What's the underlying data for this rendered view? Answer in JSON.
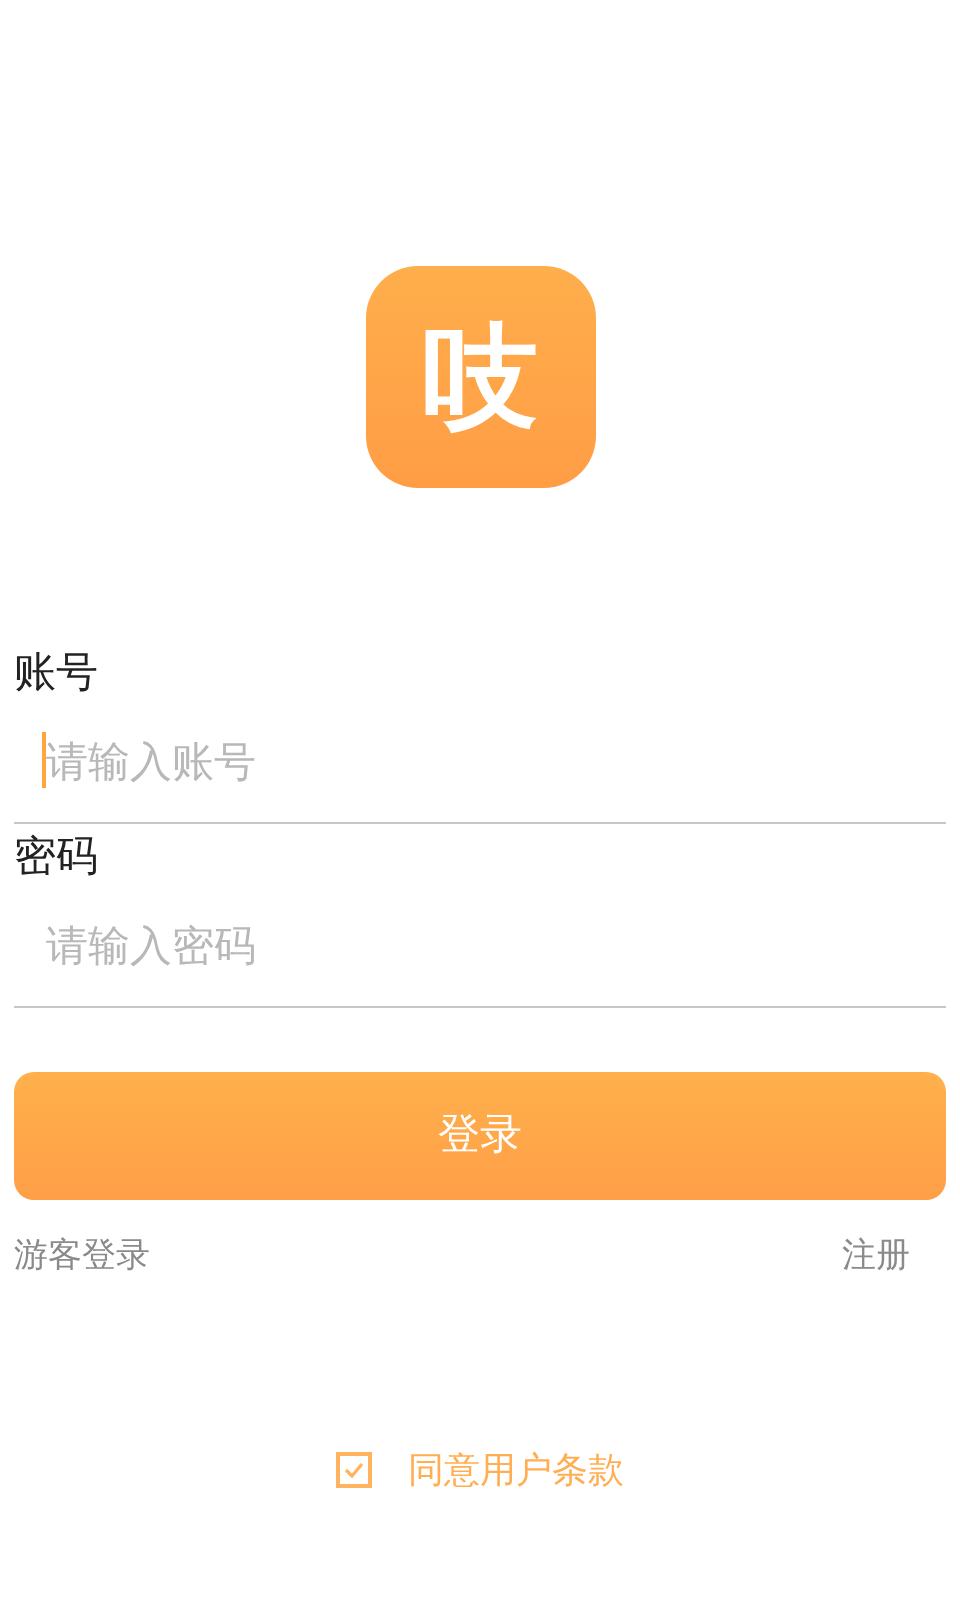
{
  "logo": {
    "text": "吱"
  },
  "fields": [
    {
      "label": "账号",
      "placeholder": "请输入账号",
      "focused": true
    },
    {
      "label": "密码",
      "placeholder": "请输入密码",
      "focused": false
    }
  ],
  "login_button": "登录",
  "links": [
    "游客登录",
    "注册"
  ],
  "agreement": {
    "label": "同意用户条款",
    "checked": true
  }
}
